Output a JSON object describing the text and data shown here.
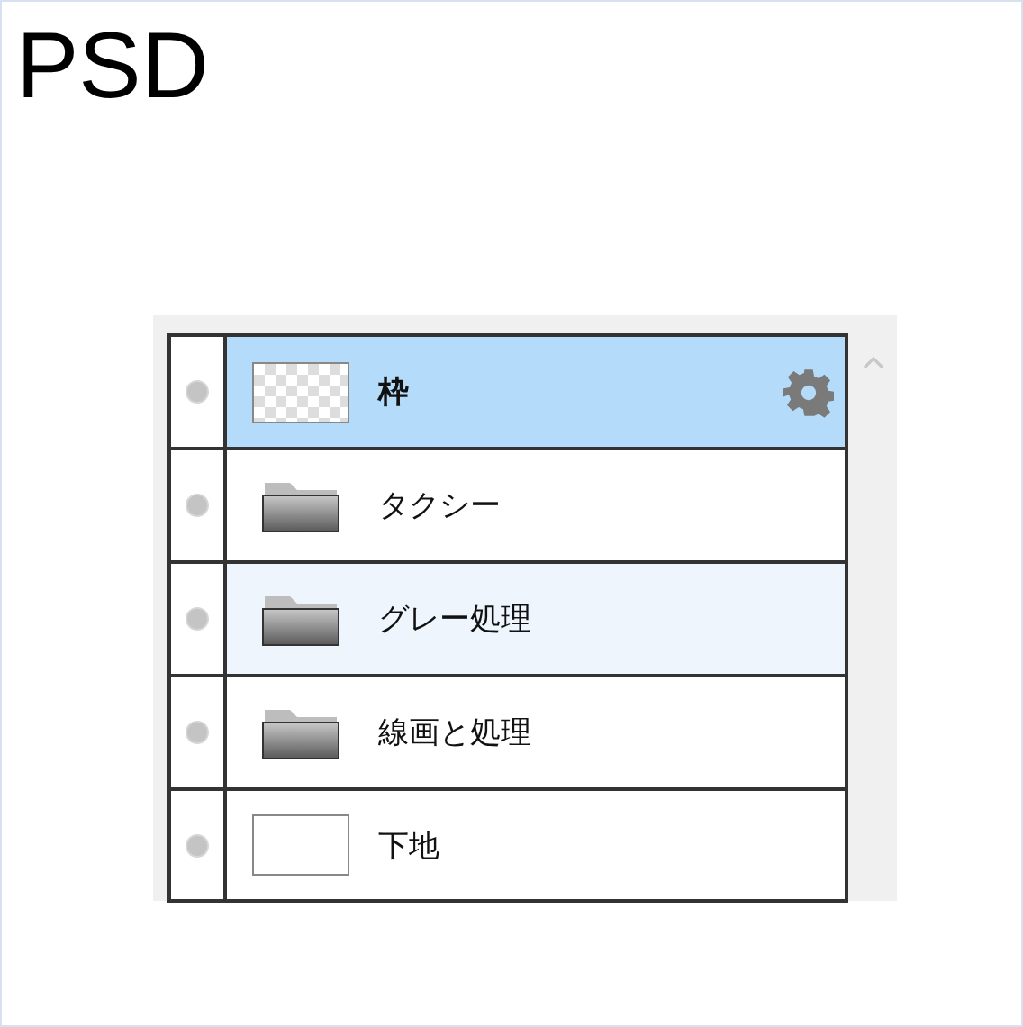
{
  "title": "PSD",
  "layers": [
    {
      "name": "枠",
      "kind": "transparent",
      "selected": true,
      "hovered": false,
      "settings": true
    },
    {
      "name": "タクシー",
      "kind": "folder",
      "selected": false,
      "hovered": false,
      "settings": false
    },
    {
      "name": "グレー処理",
      "kind": "folder",
      "selected": false,
      "hovered": true,
      "settings": false
    },
    {
      "name": "線画と処理",
      "kind": "folder",
      "selected": false,
      "hovered": false,
      "settings": false
    },
    {
      "name": "下地",
      "kind": "blank",
      "selected": false,
      "hovered": false,
      "settings": false
    }
  ]
}
